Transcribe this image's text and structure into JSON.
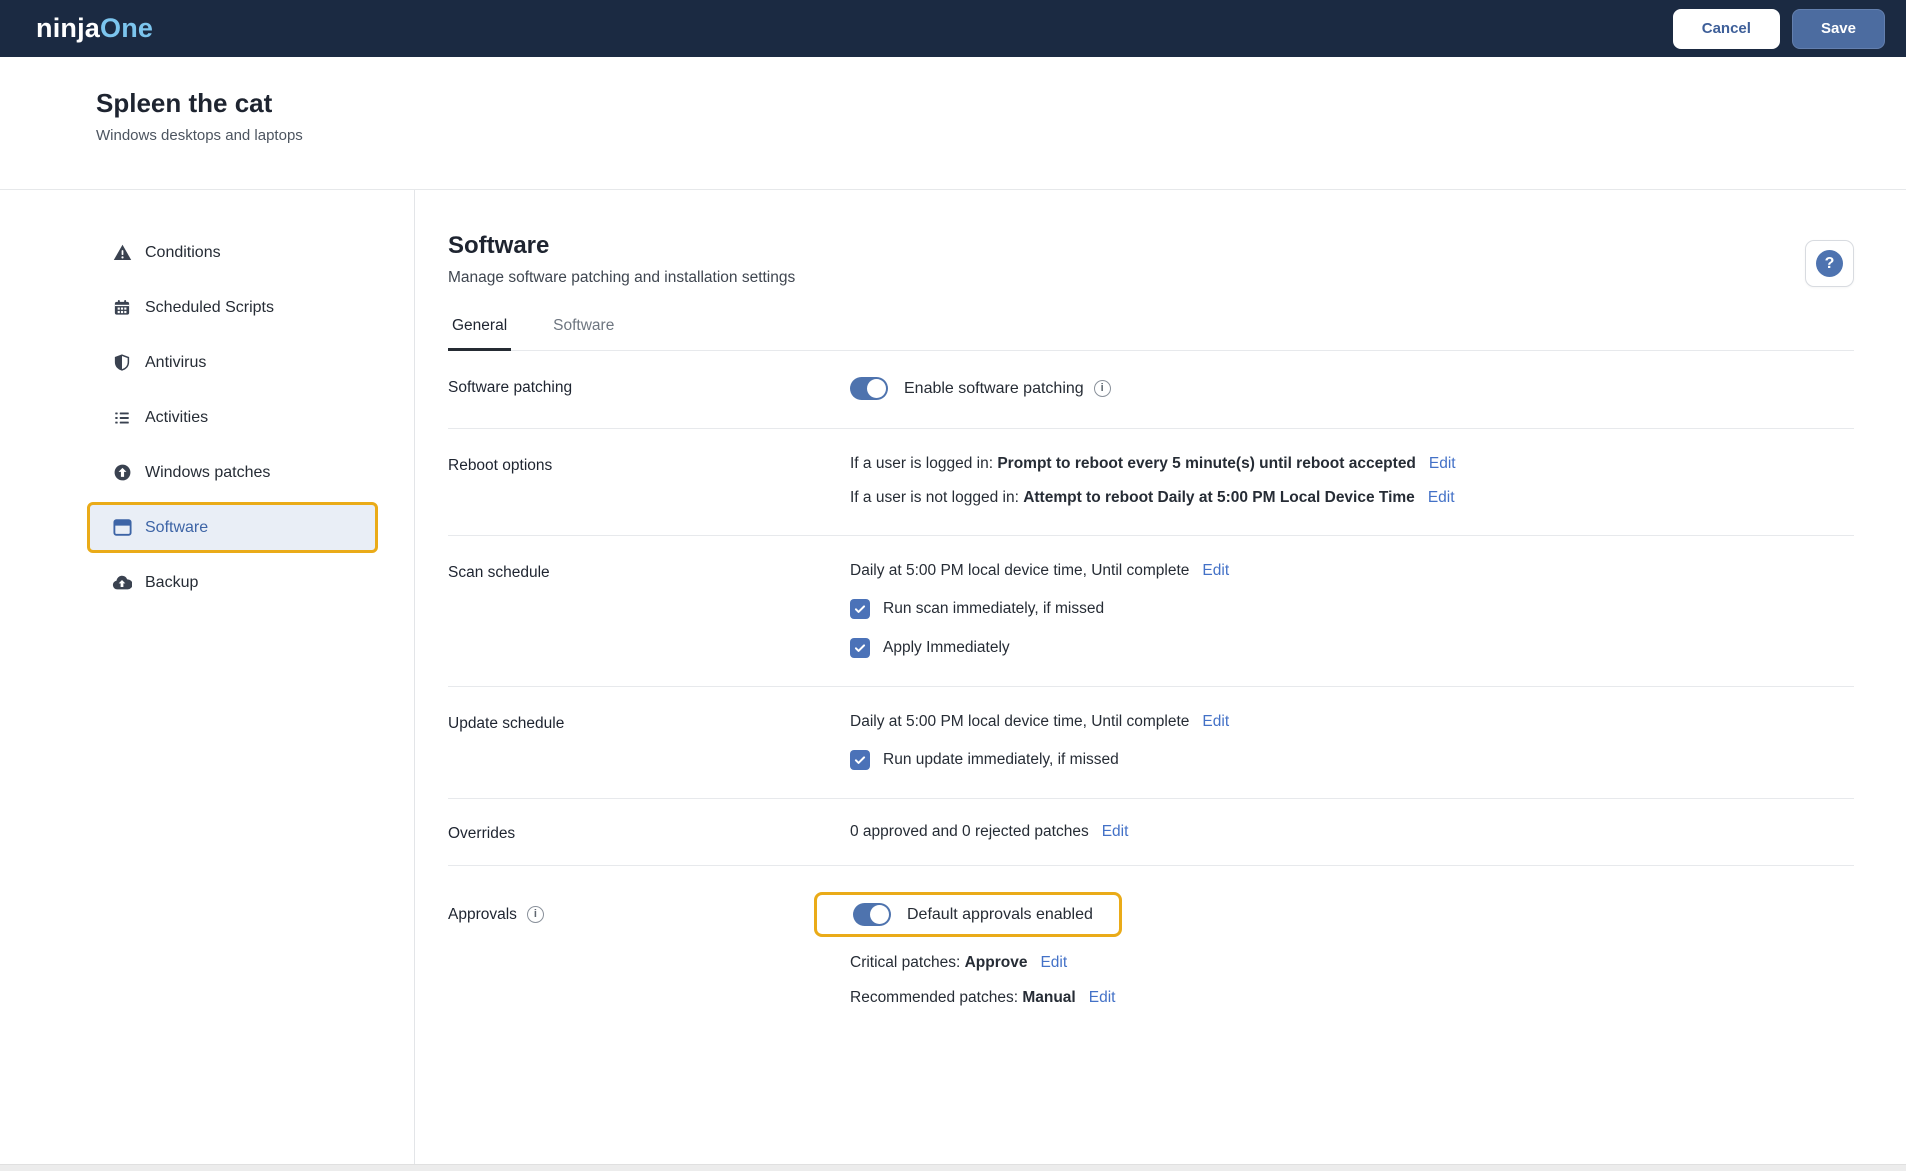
{
  "navbar": {
    "logo_part1": "ninja",
    "logo_part2": "One",
    "cancel_label": "Cancel",
    "save_label": "Save"
  },
  "page_header": {
    "title": "Spleen the cat",
    "subtitle": "Windows desktops and laptops"
  },
  "sidebar": {
    "items": [
      {
        "label": "Conditions",
        "icon": "warning-triangle-icon",
        "selected": false
      },
      {
        "label": "Scheduled Scripts",
        "icon": "calendar-icon",
        "selected": false
      },
      {
        "label": "Antivirus",
        "icon": "shield-icon",
        "selected": false
      },
      {
        "label": "Activities",
        "icon": "list-icon",
        "selected": false
      },
      {
        "label": "Windows patches",
        "icon": "arrow-up-circle-icon",
        "selected": false
      },
      {
        "label": "Software",
        "icon": "window-icon",
        "selected": true,
        "highlighted_border": true
      },
      {
        "label": "Backup",
        "icon": "cloud-upload-icon",
        "selected": false
      }
    ]
  },
  "main": {
    "title": "Software",
    "subtitle": "Manage software patching and installation settings",
    "help_button": {
      "icon": "question-mark-icon",
      "glyph": "?"
    },
    "tabs": [
      {
        "label": "General",
        "active": true
      },
      {
        "label": "Software",
        "active": false
      }
    ],
    "rows": {
      "software_patching": {
        "label": "Software patching",
        "toggle_on": true,
        "toggle_label": "Enable software patching",
        "info_glyph": "i"
      },
      "reboot_options": {
        "label": "Reboot options",
        "line1": {
          "prefix": "If a user is logged in: ",
          "value": "Prompt to reboot every 5 minute(s) until reboot accepted",
          "edit_label": "Edit"
        },
        "line2": {
          "prefix": "If a user is not logged in: ",
          "value": "Attempt to reboot Daily at 5:00 PM Local Device Time",
          "edit_label": "Edit"
        }
      },
      "scan_schedule": {
        "label": "Scan schedule",
        "value": "Daily at 5:00 PM local device time, Until complete",
        "edit_label": "Edit",
        "checkboxes": [
          {
            "label": "Run scan immediately, if missed",
            "checked": true
          },
          {
            "label": "Apply Immediately",
            "checked": true
          }
        ]
      },
      "update_schedule": {
        "label": "Update schedule",
        "value": "Daily at 5:00 PM local device time, Until complete",
        "edit_label": "Edit",
        "checkboxes": [
          {
            "label": "Run update immediately, if missed",
            "checked": true
          }
        ]
      },
      "overrides": {
        "label": "Overrides",
        "value": "0 approved and 0 rejected patches",
        "edit_label": "Edit"
      },
      "approvals": {
        "label": "Approvals",
        "info_glyph": "i",
        "toggle_on": true,
        "toggle_label": "Default approvals enabled",
        "highlighted_border": true,
        "critical": {
          "prefix": "Critical patches: ",
          "value": "Approve",
          "edit_label": "Edit"
        },
        "recommended": {
          "prefix": "Recommended patches: ",
          "value": "Manual",
          "edit_label": "Edit"
        }
      }
    }
  },
  "colors": {
    "navbar_bg": "#1b2a42",
    "logo_accent": "#7cc5ee",
    "accent_blue": "#4e73b0",
    "link_blue": "#4371c7",
    "highlight_yellow": "#eaab18",
    "selected_item_bg": "#e9eef6",
    "selected_item_text": "#3d64a6"
  }
}
